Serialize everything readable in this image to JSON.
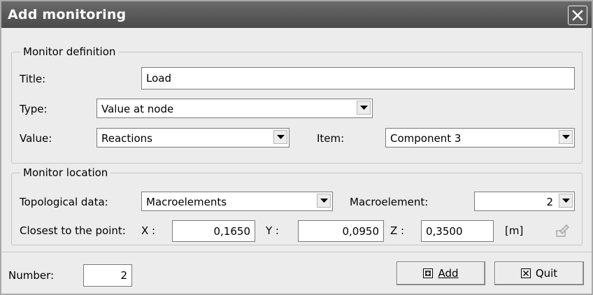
{
  "window": {
    "title": "Add monitoring"
  },
  "monitor_definition": {
    "legend": "Monitor definition",
    "title_label": "Title:",
    "title_value": "Load",
    "type_label": "Type:",
    "type_value": "Value at node",
    "value_label": "Value:",
    "value_value": "Reactions",
    "item_label": "Item:",
    "item_value": "Component 3"
  },
  "monitor_location": {
    "legend": "Monitor location",
    "topological_label": "Topological data:",
    "topological_value": "Macroelements",
    "macroelement_label": "Macroelement:",
    "macroelement_value": "2",
    "closest_label": "Closest to the point:",
    "x_label": "X :",
    "x_value": "0,1650",
    "y_label": "Y :",
    "y_value": "0,0950",
    "z_label": "Z :",
    "z_value": "0,3500",
    "unit": "[m]"
  },
  "footer": {
    "number_label": "Number:",
    "number_value": "2",
    "add_label": "Add",
    "quit_label": "Quit"
  },
  "icons": {
    "close": "close-icon",
    "dropdown": "chevron-down-icon",
    "pick_point": "pick-point-icon",
    "add": "add-icon",
    "quit": "quit-icon"
  }
}
